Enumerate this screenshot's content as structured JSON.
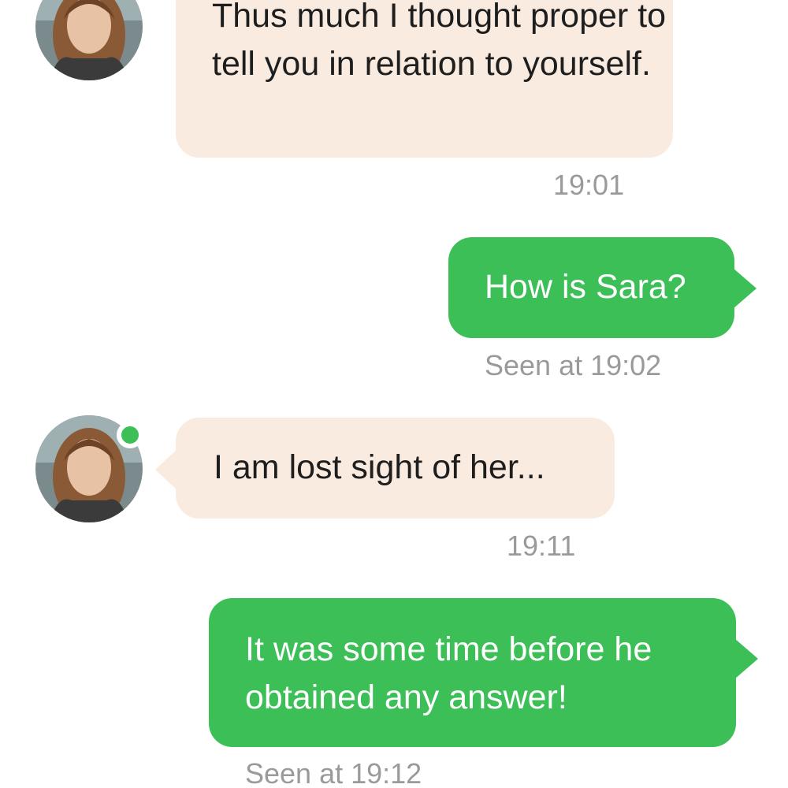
{
  "colors": {
    "incoming_bubble": "#f9ebe0",
    "outgoing_bubble": "#3cbf56",
    "online_indicator": "#3cbf56",
    "timestamp": "#9a9a9a"
  },
  "messages": [
    {
      "direction": "incoming",
      "text": "Thus much I thought proper to tell you in relation to yourself.",
      "time": "19:01",
      "avatar": "contact-avatar-icon"
    },
    {
      "direction": "outgoing",
      "text": "How is Sara?",
      "time": "Seen at 19:02"
    },
    {
      "direction": "incoming",
      "text": "I am lost sight of her...",
      "time": "19:11",
      "avatar": "contact-avatar-icon",
      "online_indicator": true
    },
    {
      "direction": "outgoing",
      "text": "It was some time before he obtained any answer!",
      "time": "Seen at 19:12"
    }
  ]
}
